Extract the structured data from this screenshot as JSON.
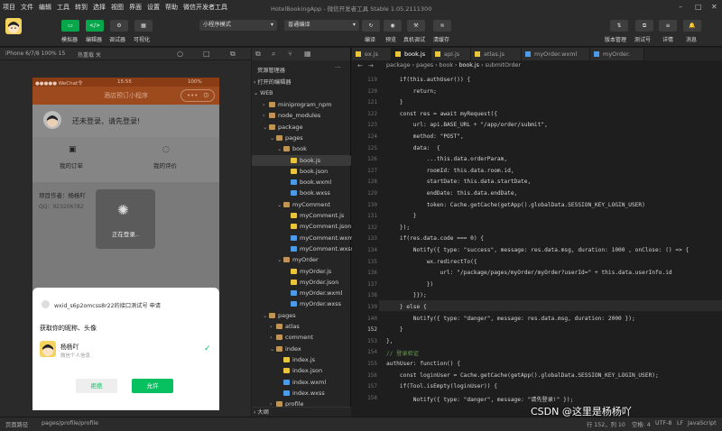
{
  "menu": [
    "项目",
    "文件",
    "编辑",
    "工具",
    "转到",
    "选择",
    "视图",
    "界面",
    "设置",
    "帮助",
    "微信开发者工具"
  ],
  "window_title": "HotelBookingApp - 微信开发者工具 Stable 1.05.2111300",
  "toolbar": {
    "simulator": "模拟器",
    "editor": "编辑器",
    "debugger": "调试器",
    "visual": "可视化",
    "mode": "小程序模式",
    "compile": "普通编译",
    "compile_btn": "编译",
    "preview": "预览",
    "real_debug": "真机调试",
    "clear_cache": "清缓存",
    "version": "版本管理",
    "test": "测试号",
    "details": "详情",
    "messages": "消息"
  },
  "sim_bar": {
    "device": "iPhone 6/7/8 100% 15",
    "hotreload": "热重载 关"
  },
  "phone": {
    "carrier": "●●●●● WeChat令",
    "time": "15:55",
    "battery": "100%",
    "title": "酒店预订小程序",
    "login_prompt": "还未登录、请先登录!",
    "order_label": "我的订单",
    "review_label": "我的评价",
    "author_label": "项目作者：杨杨吖",
    "qq_label": "QQ：",
    "qq_value": "923206782",
    "toast": "正在登录..",
    "modal_app": "wxid_s6p2omcss8r22的接口测试号 申请",
    "modal_ask": "获取你的昵称、头像",
    "user_name": "杨杨吖",
    "user_sub": "微信个人信息",
    "reject": "拒绝",
    "allow": "允许"
  },
  "explorer": {
    "title": "资源管理器",
    "open_editors": "打开的编辑器",
    "workspace": "WEB",
    "outline": "大纲",
    "rows": [
      {
        "name": "miniprogram_npm",
        "type": "folder",
        "depth": 1,
        "open": false
      },
      {
        "name": "node_modules",
        "type": "folder",
        "depth": 1,
        "open": false
      },
      {
        "name": "package",
        "type": "folder",
        "depth": 1,
        "open": true
      },
      {
        "name": "pages",
        "type": "folder",
        "depth": 2,
        "open": true
      },
      {
        "name": "book",
        "type": "folder",
        "depth": 3,
        "open": true
      },
      {
        "name": "book.js",
        "type": "js",
        "depth": 4,
        "selected": true
      },
      {
        "name": "book.json",
        "type": "json",
        "depth": 4
      },
      {
        "name": "book.wxml",
        "type": "wxml",
        "depth": 4
      },
      {
        "name": "book.wxss",
        "type": "wxss",
        "depth": 4
      },
      {
        "name": "myComment",
        "type": "folder",
        "depth": 3,
        "open": true
      },
      {
        "name": "myComment.js",
        "type": "js",
        "depth": 4
      },
      {
        "name": "myComment.json",
        "type": "json",
        "depth": 4
      },
      {
        "name": "myComment.wxml",
        "type": "wxml",
        "depth": 4
      },
      {
        "name": "myComment.wxss",
        "type": "wxss",
        "depth": 4
      },
      {
        "name": "myOrder",
        "type": "folder",
        "depth": 3,
        "open": true
      },
      {
        "name": "myOrder.js",
        "type": "js",
        "depth": 4
      },
      {
        "name": "myOrder.json",
        "type": "json",
        "depth": 4
      },
      {
        "name": "myOrder.wxml",
        "type": "wxml",
        "depth": 4
      },
      {
        "name": "myOrder.wxss",
        "type": "wxss",
        "depth": 4
      },
      {
        "name": "pages",
        "type": "folder",
        "depth": 1,
        "open": true
      },
      {
        "name": "atlas",
        "type": "folder",
        "depth": 2,
        "open": false
      },
      {
        "name": "comment",
        "type": "folder",
        "depth": 2,
        "open": false
      },
      {
        "name": "index",
        "type": "folder",
        "depth": 2,
        "open": true
      },
      {
        "name": "index.js",
        "type": "js",
        "depth": 3
      },
      {
        "name": "index.json",
        "type": "json",
        "depth": 3
      },
      {
        "name": "index.wxml",
        "type": "wxml",
        "depth": 3
      },
      {
        "name": "index.wxss",
        "type": "wxss",
        "depth": 3
      },
      {
        "name": "profile",
        "type": "folder",
        "depth": 2,
        "open": false
      }
    ]
  },
  "tabs": [
    {
      "label": "ex.js",
      "type": "js"
    },
    {
      "label": "book.js",
      "type": "js",
      "active": true
    },
    {
      "label": "api.js",
      "type": "js"
    },
    {
      "label": "atlas.js",
      "type": "js"
    },
    {
      "label": "myOrder.wxml",
      "type": "wxml"
    },
    {
      "label": "myOrder.",
      "type": "wxml"
    }
  ],
  "breadcrumb": [
    "package",
    "pages",
    "book",
    "book.js",
    "submitOrder"
  ],
  "code_lines": [
    {
      "n": "119",
      "t": "    if(this.authUser()) {"
    },
    {
      "n": "120",
      "t": "        return;"
    },
    {
      "n": "121",
      "t": "    }"
    },
    {
      "n": "122",
      "t": "    const res = await myRequest({"
    },
    {
      "n": "123",
      "t": "        url: api.BASE_URL + \"/app/order/submit\","
    },
    {
      "n": "124",
      "t": "        method: \"POST\","
    },
    {
      "n": "125",
      "t": "        data:  {"
    },
    {
      "n": "126",
      "t": "            ...this.data.orderParam,"
    },
    {
      "n": "127",
      "t": "            roomId: this.data.room.id,"
    },
    {
      "n": "128",
      "t": "            startDate: this.data.startDate,"
    },
    {
      "n": "129",
      "t": "            endDate: this.data.endDate,"
    },
    {
      "n": "130",
      "t": "            token: Cache.getCache(getApp().globalData.SESSION_KEY_LOGIN_USER)"
    },
    {
      "n": "131",
      "t": "        }"
    },
    {
      "n": "132",
      "t": "    });"
    },
    {
      "n": "133",
      "t": "    if(res.data.code === 0) {"
    },
    {
      "n": "134",
      "t": "        Notify({ type: \"success\", message: res.data.msg, duration: 1000 , onClose: () => {"
    },
    {
      "n": "135",
      "t": "            wx.redirectTo({"
    },
    {
      "n": "136",
      "t": "                url: \"/package/pages/myOrder/myOrder?userId=\" + this.data.userInfo.id"
    },
    {
      "n": "137",
      "t": "            })"
    },
    {
      "n": "138",
      "t": "        }});"
    },
    {
      "n": "139",
      "t": "    } else {"
    },
    {
      "n": "140",
      "t": "        Notify({ type: \"danger\", message: res.data.msg, duration: 2000 });"
    },
    {
      "n": "152",
      "t": "    }"
    },
    {
      "n": "153",
      "t": "},"
    },
    {
      "n": "154",
      "t": "// 登录验证"
    },
    {
      "n": "155",
      "t": "authUser: function() {"
    },
    {
      "n": "156",
      "t": "    const loginUser = Cache.getCache(getApp().globalData.SESSION_KEY_LOGIN_USER);"
    },
    {
      "n": "157",
      "t": "    if(Tool.isEmpty(loginUser)) {"
    },
    {
      "n": "158",
      "t": "        Notify({ type: \"danger\", message: \"请先登录!\" });"
    }
  ],
  "status": {
    "page_path_label": "页面路径",
    "page_path": "pages/profile/profile",
    "cursor": "行 152，列 10",
    "spaces": "空格: 4",
    "encoding": "UTF-8",
    "eol": "LF",
    "language": "JavaScript",
    "watermark": "CSDN @这里是杨杨吖"
  }
}
